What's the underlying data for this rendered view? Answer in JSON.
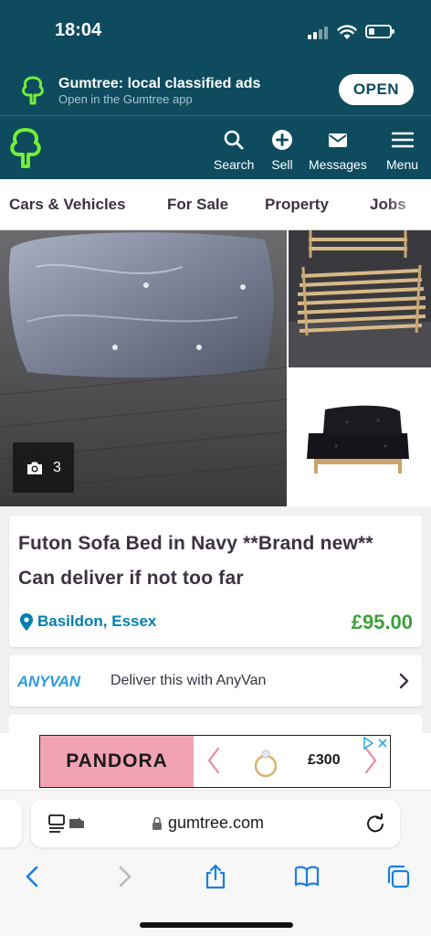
{
  "status": {
    "time": "18:04",
    "battery_level": 0.3
  },
  "app_banner": {
    "title": "Gumtree: local classified ads",
    "subtitle": "Open in the Gumtree app",
    "open_label": "OPEN"
  },
  "nav": {
    "items": [
      {
        "label": "Search",
        "icon": "search-icon"
      },
      {
        "label": "Sell",
        "icon": "plus-circle-icon"
      },
      {
        "label": "Messages",
        "icon": "mail-icon"
      },
      {
        "label": "Menu",
        "icon": "hamburger-icon"
      }
    ]
  },
  "categories": [
    "Cars & Vehicles",
    "For Sale",
    "Property",
    "Jobs"
  ],
  "gallery": {
    "photo_count": "3"
  },
  "listing": {
    "title": "Futon Sofa Bed in Navy **Brand new** Can deliver if not too far",
    "location": "Basildon, Essex",
    "price": "£95.00"
  },
  "anyvan": {
    "logo": "ANYVAN",
    "text": "Deliver this with AnyVan"
  },
  "ad": {
    "brand": "PANDORA",
    "price": "£300"
  },
  "browser": {
    "url": "gumtree.com"
  },
  "colors": {
    "brand_header": "#0e4b5e",
    "brand_green": "#72ef36",
    "price_green": "#3d9f3d",
    "link_blue": "#007fb0"
  }
}
